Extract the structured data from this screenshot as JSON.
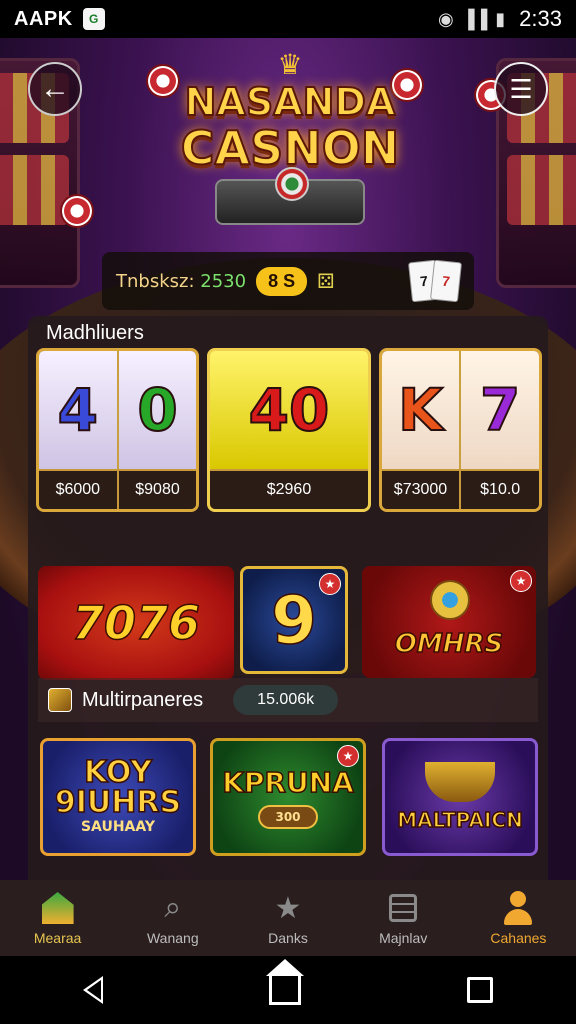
{
  "status_bar": {
    "carrier": "AAPK",
    "app_badge": "G",
    "time": "2:33"
  },
  "header": {
    "logo_line1": "NASANDA",
    "logo_line2": "CASNON",
    "back_icon": "arrow-left-icon",
    "menu_icon": "menu-icon"
  },
  "tickets": {
    "label": "Tnbsksz:",
    "value": "2530",
    "pill": "8 S",
    "cards": [
      "7",
      "7"
    ]
  },
  "panel": {
    "title": "Madhliuers",
    "slots": [
      {
        "symbols": [
          "4",
          "0"
        ],
        "colors": [
          "#3a4ad8",
          "#28a828"
        ],
        "prices": [
          "$6000",
          "$9080"
        ],
        "style": "silver"
      },
      {
        "symbols": [
          "40"
        ],
        "colors": [
          "#d81a1a"
        ],
        "prices": [
          "$2960"
        ],
        "style": "gold"
      },
      {
        "symbols": [
          "K",
          "7"
        ],
        "colors": [
          "#e8541a",
          "#9a2ad8"
        ],
        "prices": [
          "$73000",
          "$10.0"
        ],
        "style": "warm"
      }
    ],
    "featured": {
      "tile_a": "7076",
      "tile_b": "9",
      "tile_c": "OMHRS"
    },
    "multi_bar": {
      "label": "Multirpaneres",
      "value": "15.006k"
    },
    "games": [
      {
        "title": "KOY 9IUHRS",
        "subtitle": "SAUHAAY"
      },
      {
        "title": "KPRUNA",
        "subtitle": "300"
      },
      {
        "title": "MALTPAICN"
      }
    ]
  },
  "bottom_nav": [
    {
      "label": "Mearaa",
      "icon": "home-icon"
    },
    {
      "label": "Wanang",
      "icon": "search-icon"
    },
    {
      "label": "Danks",
      "icon": "star-icon"
    },
    {
      "label": "Majnlav",
      "icon": "calendar-icon"
    },
    {
      "label": "Cahanes",
      "icon": "profile-icon"
    }
  ]
}
